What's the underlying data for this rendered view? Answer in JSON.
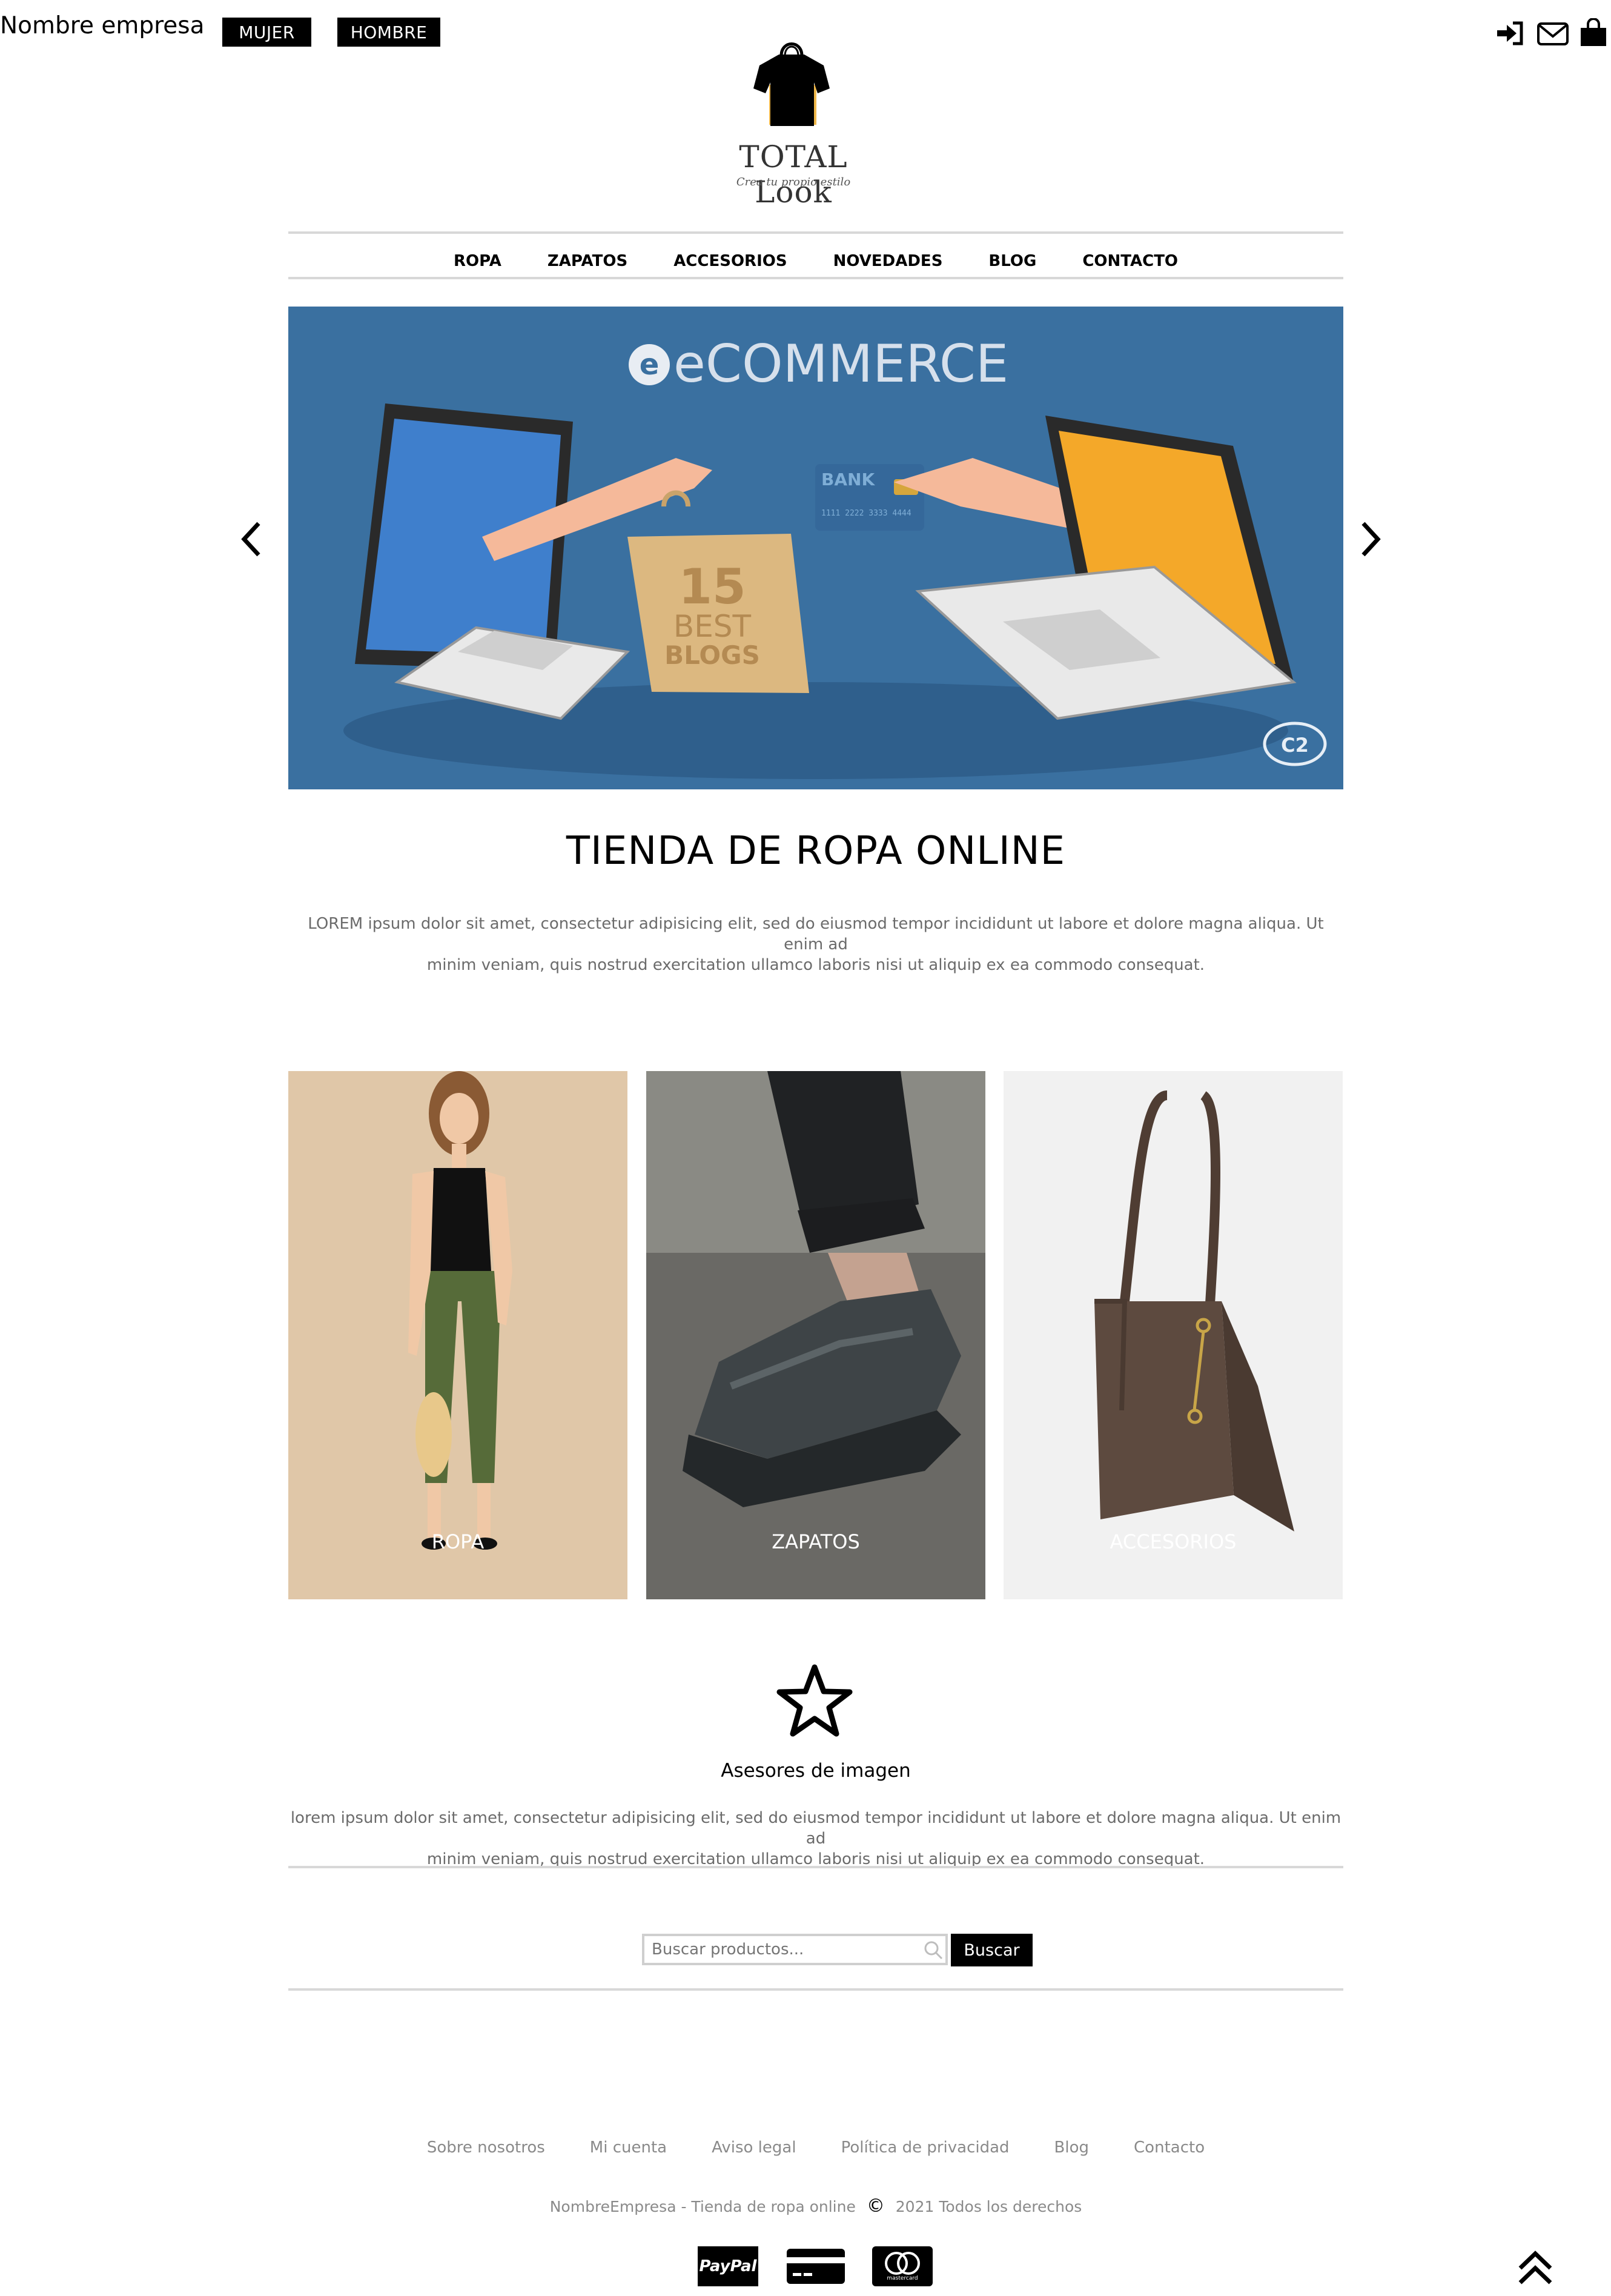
{
  "header": {
    "brand": "Nombre empresa",
    "gender_buttons": [
      "MUJER",
      "HOMBRE"
    ],
    "icons": [
      "sign-in-icon",
      "envelope-icon",
      "shopping-bag-icon"
    ]
  },
  "logo": {
    "title": "TOTAL Look",
    "subtitle": "Crea tu propio estilo"
  },
  "nav": {
    "items": [
      "ROPA",
      "ZAPATOS",
      "ACCESORIOS",
      "NOVEDADES",
      "BLOG",
      "CONTACTO"
    ]
  },
  "hero": {
    "banner_title": "eCOMMERCE",
    "bag_text": [
      "15",
      "BEST",
      "BLOGS"
    ],
    "card_text": "BANK",
    "card_number": "1111 2222 3333 4444",
    "badge": "C2"
  },
  "intro": {
    "title": "TIENDA DE ROPA ONLINE",
    "text_line1": "LOREM ipsum dolor sit amet, consectetur adipisicing elit, sed do eiusmod tempor incididunt ut labore et dolore magna aliqua. Ut enim ad",
    "text_line2": "minim veniam, quis nostrud exercitation ullamco laboris nisi ut aliquip ex ea commodo consequat."
  },
  "categories": [
    {
      "label": "ROPA"
    },
    {
      "label": "ZAPATOS"
    },
    {
      "label": "ACCESORIOS"
    }
  ],
  "feature": {
    "icon": "star-icon",
    "title": "Asesores de imagen",
    "text_line1": "lorem ipsum dolor sit amet, consectetur adipisicing elit, sed do eiusmod tempor incididunt ut labore et dolore magna aliqua. Ut enim ad",
    "text_line2": "minim veniam, quis nostrud exercitation ullamco laboris nisi ut aliquip ex ea commodo consequat."
  },
  "search": {
    "placeholder": "Buscar productos...",
    "button_label": "Buscar"
  },
  "footer": {
    "links": [
      "Sobre nosotros",
      "Mi cuenta",
      "Aviso legal",
      "Política de privacidad",
      "Blog",
      "Contacto"
    ],
    "company": "NombreEmpresa - Tienda de ropa online",
    "copyright_symbol": "©",
    "rights": "2021 Todos los derechos",
    "payments": [
      "PayPal",
      "credit-card-icon",
      "mastercard"
    ]
  }
}
